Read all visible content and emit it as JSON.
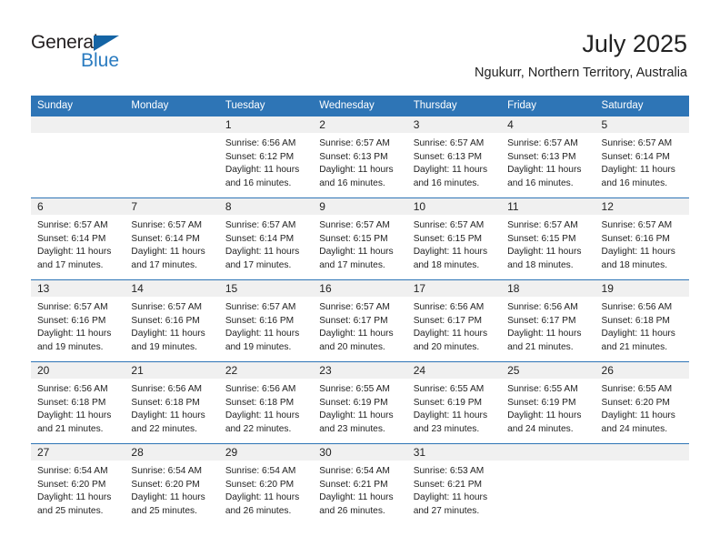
{
  "logo": {
    "word1": "General",
    "word2": "Blue",
    "triangle_color": "#1464a5",
    "blue_text_color": "#2a7bc0"
  },
  "header": {
    "title": "July 2025",
    "subtitle": "Ngukurr, Northern Territory, Australia"
  },
  "theme": {
    "header_blue": "#2e75b6",
    "daynum_band": "#f0f0f0",
    "text": "#222222"
  },
  "weekday_headers": [
    "Sunday",
    "Monday",
    "Tuesday",
    "Wednesday",
    "Thursday",
    "Friday",
    "Saturday"
  ],
  "weeks": [
    [
      {
        "day": "",
        "empty": true
      },
      {
        "day": "",
        "empty": true
      },
      {
        "day": "1",
        "sunrise": "Sunrise: 6:56 AM",
        "sunset": "Sunset: 6:12 PM",
        "daylight1": "Daylight: 11 hours",
        "daylight2": "and 16 minutes."
      },
      {
        "day": "2",
        "sunrise": "Sunrise: 6:57 AM",
        "sunset": "Sunset: 6:13 PM",
        "daylight1": "Daylight: 11 hours",
        "daylight2": "and 16 minutes."
      },
      {
        "day": "3",
        "sunrise": "Sunrise: 6:57 AM",
        "sunset": "Sunset: 6:13 PM",
        "daylight1": "Daylight: 11 hours",
        "daylight2": "and 16 minutes."
      },
      {
        "day": "4",
        "sunrise": "Sunrise: 6:57 AM",
        "sunset": "Sunset: 6:13 PM",
        "daylight1": "Daylight: 11 hours",
        "daylight2": "and 16 minutes."
      },
      {
        "day": "5",
        "sunrise": "Sunrise: 6:57 AM",
        "sunset": "Sunset: 6:14 PM",
        "daylight1": "Daylight: 11 hours",
        "daylight2": "and 16 minutes."
      }
    ],
    [
      {
        "day": "6",
        "sunrise": "Sunrise: 6:57 AM",
        "sunset": "Sunset: 6:14 PM",
        "daylight1": "Daylight: 11 hours",
        "daylight2": "and 17 minutes."
      },
      {
        "day": "7",
        "sunrise": "Sunrise: 6:57 AM",
        "sunset": "Sunset: 6:14 PM",
        "daylight1": "Daylight: 11 hours",
        "daylight2": "and 17 minutes."
      },
      {
        "day": "8",
        "sunrise": "Sunrise: 6:57 AM",
        "sunset": "Sunset: 6:14 PM",
        "daylight1": "Daylight: 11 hours",
        "daylight2": "and 17 minutes."
      },
      {
        "day": "9",
        "sunrise": "Sunrise: 6:57 AM",
        "sunset": "Sunset: 6:15 PM",
        "daylight1": "Daylight: 11 hours",
        "daylight2": "and 17 minutes."
      },
      {
        "day": "10",
        "sunrise": "Sunrise: 6:57 AM",
        "sunset": "Sunset: 6:15 PM",
        "daylight1": "Daylight: 11 hours",
        "daylight2": "and 18 minutes."
      },
      {
        "day": "11",
        "sunrise": "Sunrise: 6:57 AM",
        "sunset": "Sunset: 6:15 PM",
        "daylight1": "Daylight: 11 hours",
        "daylight2": "and 18 minutes."
      },
      {
        "day": "12",
        "sunrise": "Sunrise: 6:57 AM",
        "sunset": "Sunset: 6:16 PM",
        "daylight1": "Daylight: 11 hours",
        "daylight2": "and 18 minutes."
      }
    ],
    [
      {
        "day": "13",
        "sunrise": "Sunrise: 6:57 AM",
        "sunset": "Sunset: 6:16 PM",
        "daylight1": "Daylight: 11 hours",
        "daylight2": "and 19 minutes."
      },
      {
        "day": "14",
        "sunrise": "Sunrise: 6:57 AM",
        "sunset": "Sunset: 6:16 PM",
        "daylight1": "Daylight: 11 hours",
        "daylight2": "and 19 minutes."
      },
      {
        "day": "15",
        "sunrise": "Sunrise: 6:57 AM",
        "sunset": "Sunset: 6:16 PM",
        "daylight1": "Daylight: 11 hours",
        "daylight2": "and 19 minutes."
      },
      {
        "day": "16",
        "sunrise": "Sunrise: 6:57 AM",
        "sunset": "Sunset: 6:17 PM",
        "daylight1": "Daylight: 11 hours",
        "daylight2": "and 20 minutes."
      },
      {
        "day": "17",
        "sunrise": "Sunrise: 6:56 AM",
        "sunset": "Sunset: 6:17 PM",
        "daylight1": "Daylight: 11 hours",
        "daylight2": "and 20 minutes."
      },
      {
        "day": "18",
        "sunrise": "Sunrise: 6:56 AM",
        "sunset": "Sunset: 6:17 PM",
        "daylight1": "Daylight: 11 hours",
        "daylight2": "and 21 minutes."
      },
      {
        "day": "19",
        "sunrise": "Sunrise: 6:56 AM",
        "sunset": "Sunset: 6:18 PM",
        "daylight1": "Daylight: 11 hours",
        "daylight2": "and 21 minutes."
      }
    ],
    [
      {
        "day": "20",
        "sunrise": "Sunrise: 6:56 AM",
        "sunset": "Sunset: 6:18 PM",
        "daylight1": "Daylight: 11 hours",
        "daylight2": "and 21 minutes."
      },
      {
        "day": "21",
        "sunrise": "Sunrise: 6:56 AM",
        "sunset": "Sunset: 6:18 PM",
        "daylight1": "Daylight: 11 hours",
        "daylight2": "and 22 minutes."
      },
      {
        "day": "22",
        "sunrise": "Sunrise: 6:56 AM",
        "sunset": "Sunset: 6:18 PM",
        "daylight1": "Daylight: 11 hours",
        "daylight2": "and 22 minutes."
      },
      {
        "day": "23",
        "sunrise": "Sunrise: 6:55 AM",
        "sunset": "Sunset: 6:19 PM",
        "daylight1": "Daylight: 11 hours",
        "daylight2": "and 23 minutes."
      },
      {
        "day": "24",
        "sunrise": "Sunrise: 6:55 AM",
        "sunset": "Sunset: 6:19 PM",
        "daylight1": "Daylight: 11 hours",
        "daylight2": "and 23 minutes."
      },
      {
        "day": "25",
        "sunrise": "Sunrise: 6:55 AM",
        "sunset": "Sunset: 6:19 PM",
        "daylight1": "Daylight: 11 hours",
        "daylight2": "and 24 minutes."
      },
      {
        "day": "26",
        "sunrise": "Sunrise: 6:55 AM",
        "sunset": "Sunset: 6:20 PM",
        "daylight1": "Daylight: 11 hours",
        "daylight2": "and 24 minutes."
      }
    ],
    [
      {
        "day": "27",
        "sunrise": "Sunrise: 6:54 AM",
        "sunset": "Sunset: 6:20 PM",
        "daylight1": "Daylight: 11 hours",
        "daylight2": "and 25 minutes."
      },
      {
        "day": "28",
        "sunrise": "Sunrise: 6:54 AM",
        "sunset": "Sunset: 6:20 PM",
        "daylight1": "Daylight: 11 hours",
        "daylight2": "and 25 minutes."
      },
      {
        "day": "29",
        "sunrise": "Sunrise: 6:54 AM",
        "sunset": "Sunset: 6:20 PM",
        "daylight1": "Daylight: 11 hours",
        "daylight2": "and 26 minutes."
      },
      {
        "day": "30",
        "sunrise": "Sunrise: 6:54 AM",
        "sunset": "Sunset: 6:21 PM",
        "daylight1": "Daylight: 11 hours",
        "daylight2": "and 26 minutes."
      },
      {
        "day": "31",
        "sunrise": "Sunrise: 6:53 AM",
        "sunset": "Sunset: 6:21 PM",
        "daylight1": "Daylight: 11 hours",
        "daylight2": "and 27 minutes."
      },
      {
        "day": "",
        "empty": true
      },
      {
        "day": "",
        "empty": true
      }
    ]
  ]
}
